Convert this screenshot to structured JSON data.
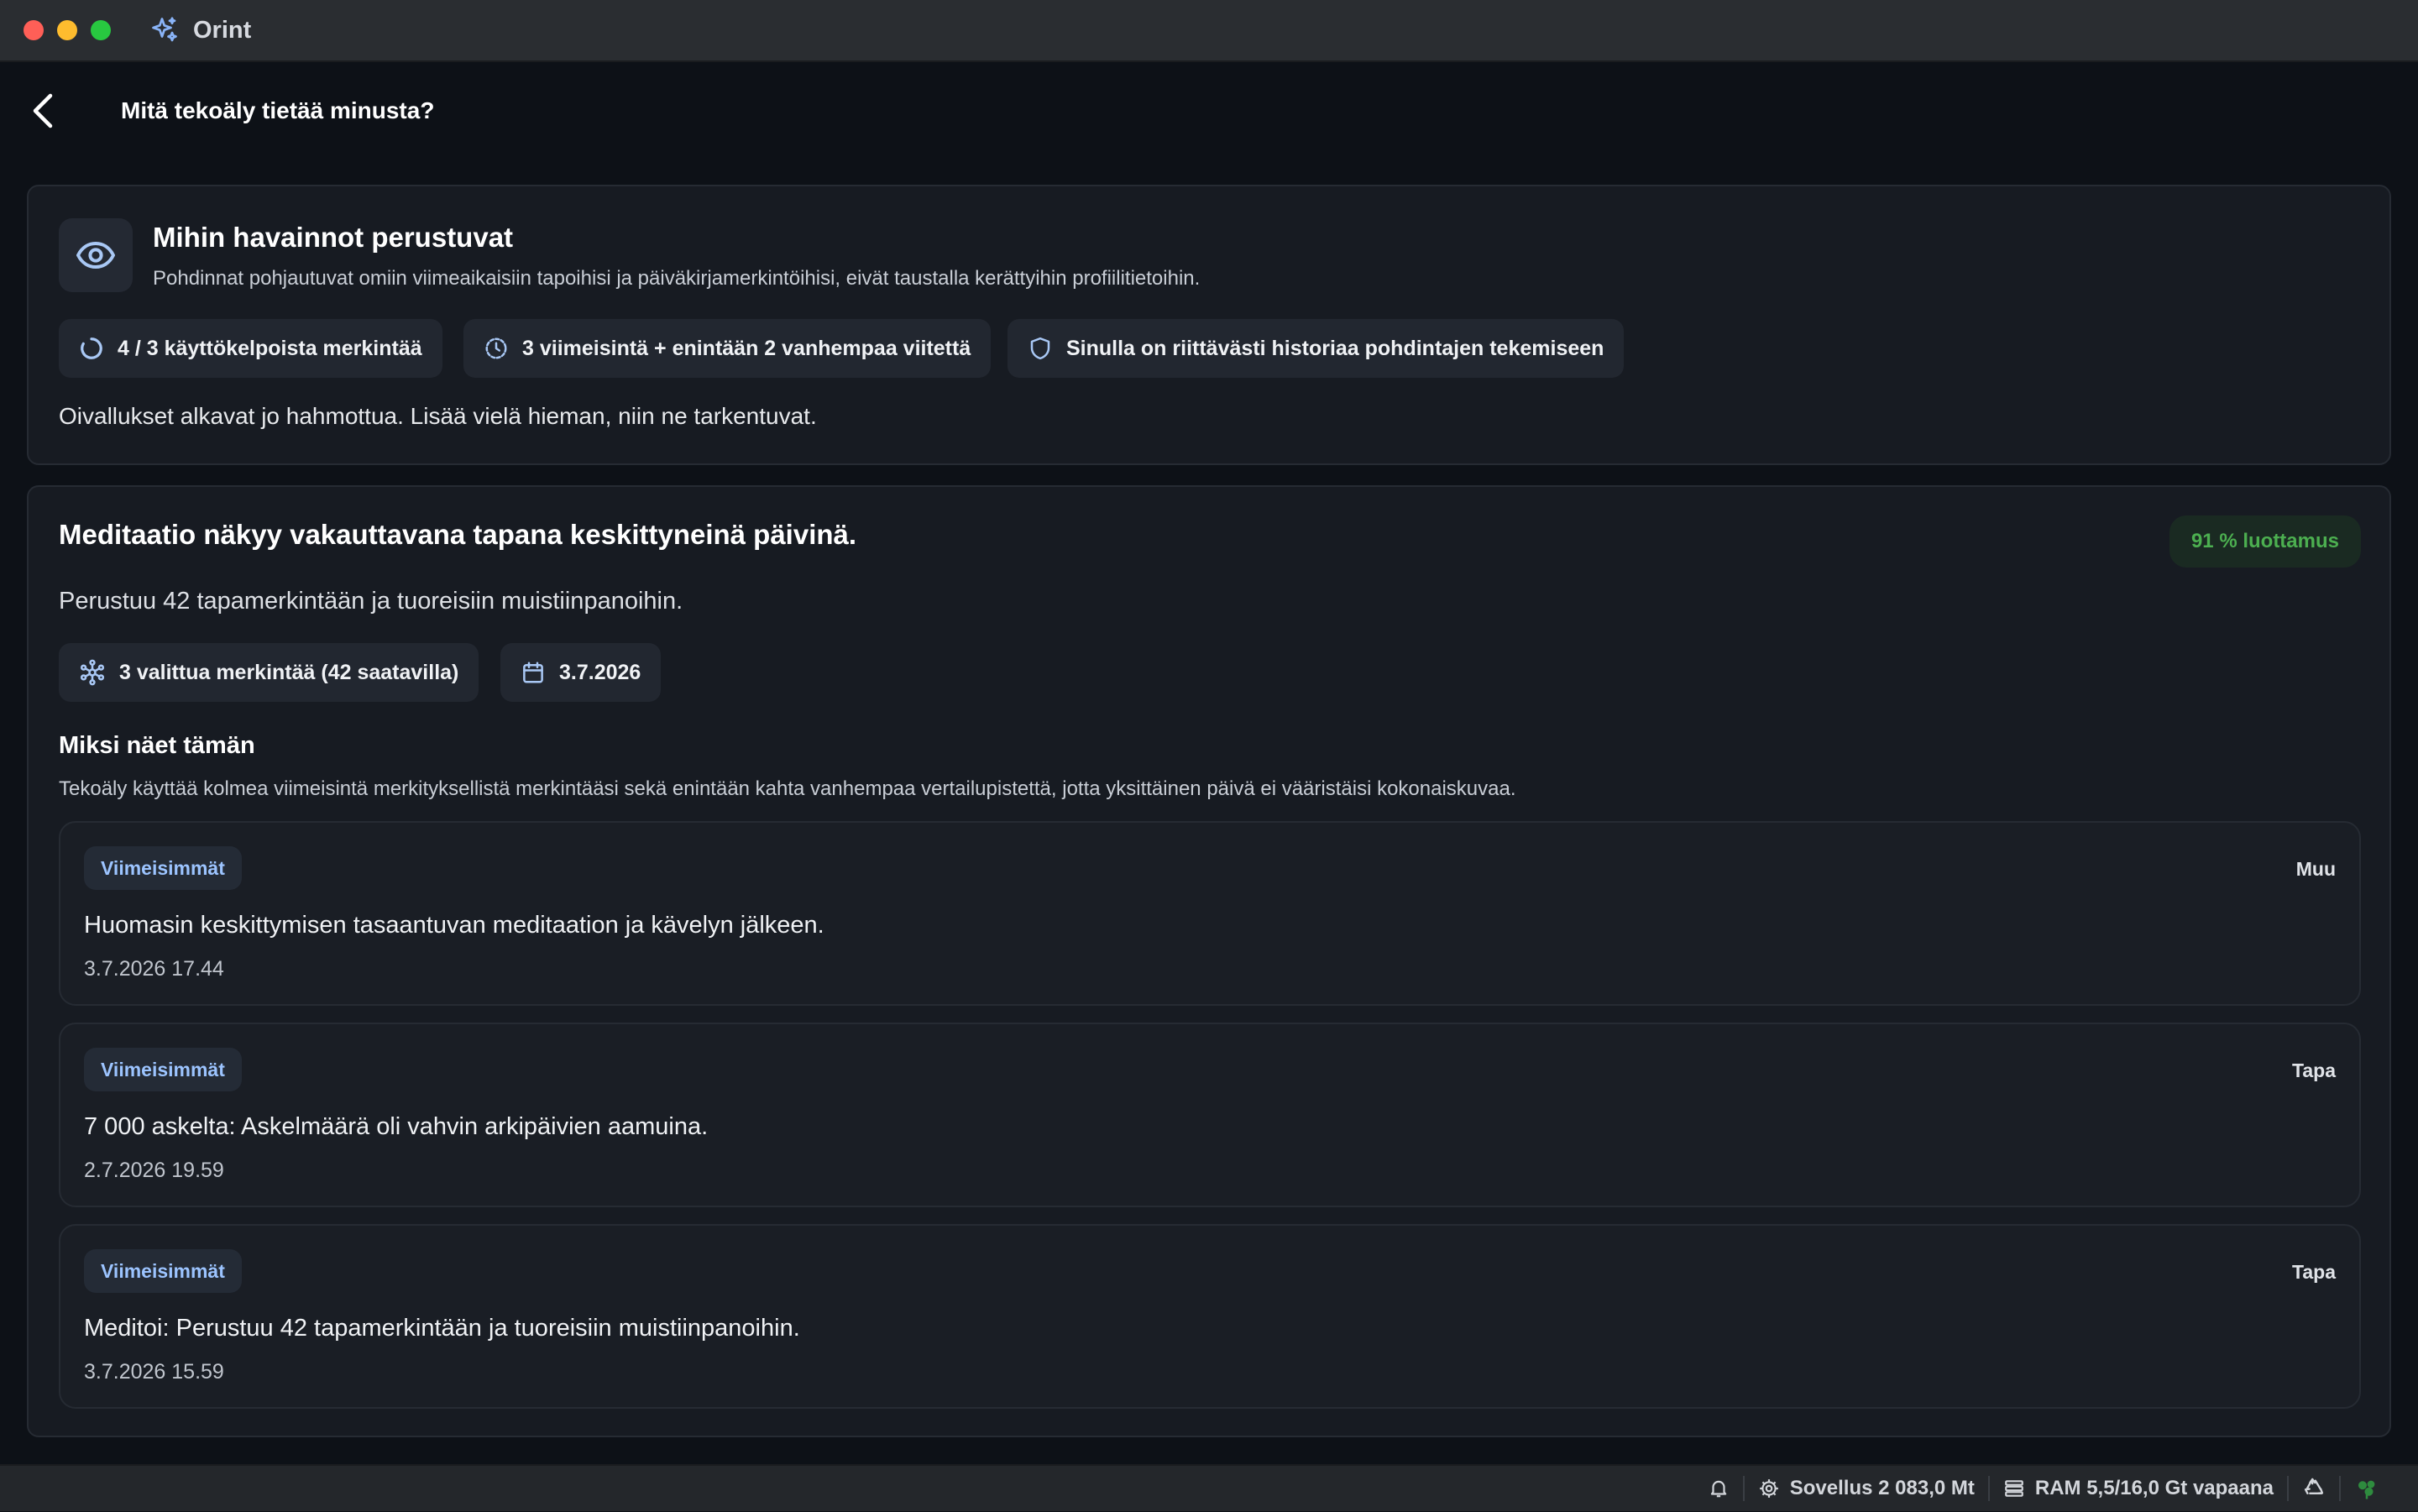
{
  "app": {
    "name": "Orint",
    "logo_icon": "sparkles-icon"
  },
  "header": {
    "title": "Mitä tekoäly tietää minusta?"
  },
  "basis_card": {
    "title": "Mihin havainnot perustuvat",
    "subtitle": "Pohdinnat pohjautuvat omiin viimeaikaisiin tapoihisi ja päiväkirjamerkintöihisi, eivät taustalla kerättyihin profiilitietoihin.",
    "chips": [
      {
        "icon": "progress-ring-icon",
        "label": "4 / 3 käyttökelpoista merkintää"
      },
      {
        "icon": "history-clock-icon",
        "label": "3 viimeisintä + enintään 2 vanhempaa viitettä"
      },
      {
        "icon": "shield-icon",
        "label": "Sinulla on riittävästi historiaa pohdintajen tekemiseen"
      }
    ],
    "message": "Oivallukset alkavat jo hahmottua. Lisää vielä hieman, niin ne tarkentuvat."
  },
  "insight_card": {
    "title": "Meditaatio näkyy vakauttavana tapana keskittyneinä päivinä.",
    "confidence": "91 % luottamus",
    "confidence_color": "#4caf50",
    "description": "Perustuu 42 tapamerkintään ja tuoreisiin muistiinpanoihin.",
    "chips": [
      {
        "icon": "network-icon",
        "label": "3 valittua merkintää (42 saatavilla)"
      },
      {
        "icon": "calendar-icon",
        "label": "3.7.2026"
      }
    ],
    "why_title": "Miksi näet tämän",
    "why_text": "Tekoäly käyttää kolmea viimeisintä merkityksellistä merkintääsi sekä enintään kahta vanhempaa vertailupistettä, jotta yksittäinen päivä ei vääristäisi kokonaiskuvaa.",
    "entries": [
      {
        "tag": "Viimeisimmät",
        "kind": "Muu",
        "text": "Huomasin keskittymisen tasaantuvan meditaation ja kävelyn jälkeen.",
        "date": "3.7.2026 17.44"
      },
      {
        "tag": "Viimeisimmät",
        "kind": "Tapa",
        "text": "7 000 askelta: Askelmäärä oli vahvin arkipäivien aamuina.",
        "date": "2.7.2026 19.59"
      },
      {
        "tag": "Viimeisimmät",
        "kind": "Tapa",
        "text": "Meditoi: Perustuu 42 tapamerkintään ja tuoreisiin muistiinpanoihin.",
        "date": "3.7.2026 15.59"
      }
    ]
  },
  "statusbar": {
    "app_memory": "Sovellus 2 083,0 Mt",
    "ram": "RAM 5,5/16,0 Gt vapaana"
  },
  "colors": {
    "accent": "#9cc4ff",
    "background": "#0d1117",
    "card": "#171b22"
  }
}
